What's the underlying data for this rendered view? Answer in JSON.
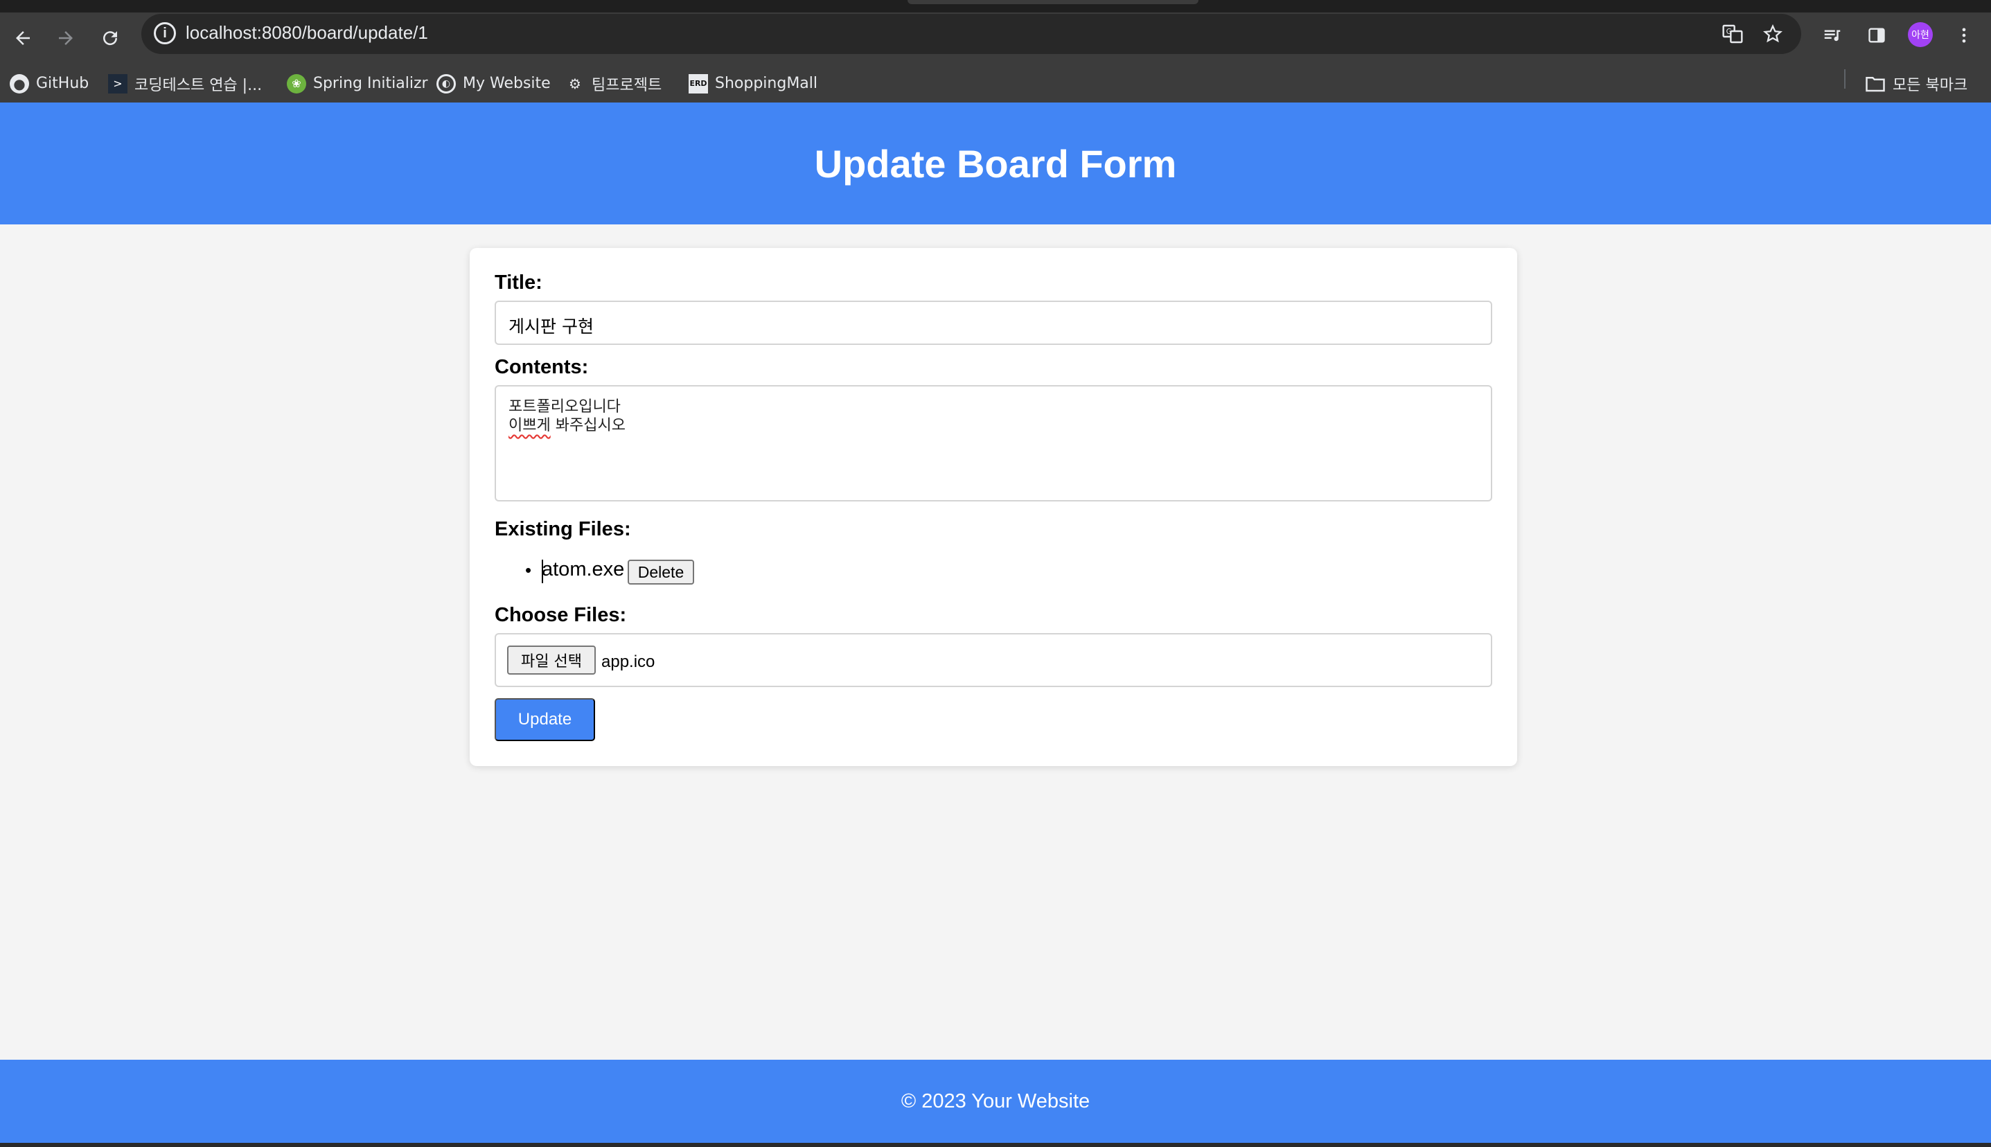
{
  "browser": {
    "url": "localhost:8080/board/update/1",
    "avatar_text": "아현",
    "icons": {
      "back": "arrow-left-icon",
      "forward": "arrow-right-icon",
      "reload": "reload-icon",
      "info": "info-icon",
      "translate": "translate-icon",
      "star": "star-icon",
      "media": "media-control-icon",
      "side_panel": "side-panel-icon",
      "menu": "kebab-menu-icon"
    },
    "bookmarks": [
      {
        "label": "GitHub",
        "icon": "github-icon"
      },
      {
        "label": "코딩테스트 연습 |...",
        "icon": "programmers-icon"
      },
      {
        "label": "Spring Initializr",
        "icon": "spring-icon"
      },
      {
        "label": "My Website",
        "icon": "globe-icon"
      },
      {
        "label": "팀프로젝트",
        "icon": "team-icon"
      },
      {
        "label": "ShoppingMall",
        "icon": "erd-icon"
      }
    ],
    "all_bookmarks_label": "모든 북마크"
  },
  "page": {
    "header_title": "Update Board Form",
    "form": {
      "title_label": "Title:",
      "title_value": "게시판 구현",
      "contents_label": "Contents:",
      "contents_line1": "포트폴리오입니다",
      "contents_line2_word1": "이쁘게",
      "contents_line2_rest": " 봐주십시오",
      "existing_files_label": "Existing Files:",
      "existing_files": [
        {
          "name": "atom.exe",
          "delete_label": "Delete"
        }
      ],
      "choose_files_label": "Choose Files:",
      "choose_button_label": "파일 선택",
      "chosen_file": "app.ico",
      "submit_label": "Update"
    },
    "footer_text": "© 2023 Your Website"
  },
  "colors": {
    "brand_blue": "#4285f4",
    "page_bg": "#f4f4f4",
    "chrome_dark": "#3c3c3c"
  }
}
